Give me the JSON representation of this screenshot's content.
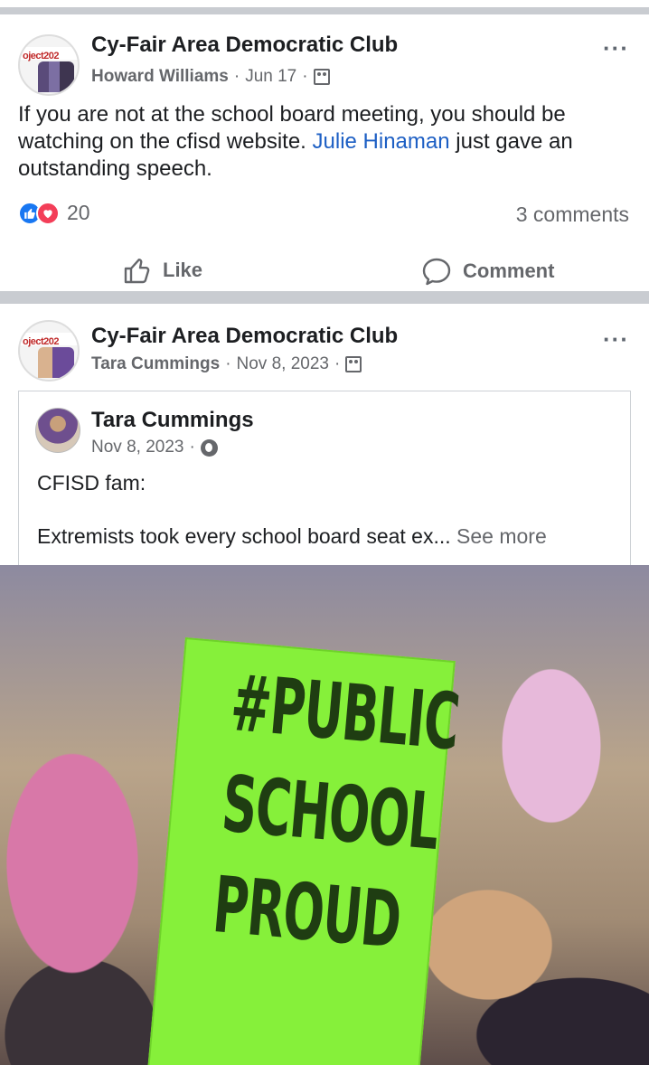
{
  "posts": [
    {
      "group_name": "Cy-Fair Area Democratic Club",
      "group_avatar_text": "oject202",
      "author": "Howard Williams",
      "date": "Jun 17",
      "text_before": "If you are not at the school board meeting,  you should be watching on the cfisd website. ",
      "mention": "Julie Hinaman",
      "text_after": " just gave an outstanding speech.",
      "reaction_count": "20",
      "comments_count": "3 comments",
      "like_label": "Like",
      "comment_label": "Comment"
    },
    {
      "group_name": "Cy-Fair Area Democratic Club",
      "group_avatar_text": "oject202",
      "author": "Tara Cummings",
      "date": "Nov 8, 2023",
      "shared": {
        "author": "Tara Cummings",
        "date": "Nov 8, 2023",
        "line1": "CFISD fam:",
        "line2": "Extremists took every school board seat ex...",
        "see_more": "See more"
      },
      "photo_sign_lines": [
        "#PUBLIC",
        "SCHOOL",
        "PROUD"
      ]
    }
  ],
  "icons": {
    "more": "more-horizontal-icon",
    "group": "group-icon",
    "globe": "globe-icon",
    "like": "thumbs-up-icon",
    "comment": "comment-bubble-icon"
  },
  "colors": {
    "link": "#1d5fc4",
    "like_reaction": "#1877f2",
    "love_reaction": "#f33e58",
    "secondary_text": "#65676b",
    "divider": "#c9ccd1",
    "sign_green": "#86f03a"
  }
}
